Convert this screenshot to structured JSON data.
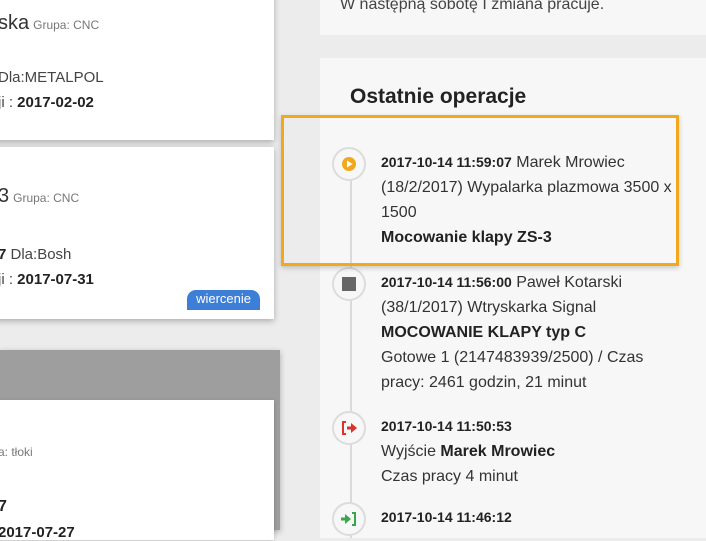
{
  "cards": [
    {
      "title": "ska",
      "group": "Grupa: CNC",
      "line1": "Dla:METALPOL",
      "line2_prefix": "ji : ",
      "line2_value": "2017-02-02"
    },
    {
      "title": "3",
      "group": "Grupa: CNC",
      "line1_num": "7",
      "line1": "Dla:Bosh",
      "line2_prefix": "ji : ",
      "line2_value": "2017-07-31",
      "badge": "wiercenie"
    }
  ],
  "section3": {
    "group": "a: tłoki",
    "num": "7",
    "partial": "2017-07-27"
  },
  "notice": "W następną sobotę I zmiana pracuje.",
  "operations": {
    "title": "Ostatnie operacje",
    "items": [
      {
        "timestamp": "2017-10-14 11:59:07",
        "user": "Marek Mrowiec",
        "detail": "(18/2/2017) Wypalarka plazmowa 3500 x 1500",
        "bold_line": "Mocowanie klapy ZS-3",
        "icon": "play-icon",
        "icon_color": "#f2a81c"
      },
      {
        "timestamp": "2017-10-14 11:56:00",
        "user": "Paweł Kotarski",
        "detail": "(38/1/2017) Wtryskarka Signal",
        "bold_line": "MOCOWANIE KLAPY typ C",
        "extra": "Gotowe 1 (2147483939/2500) / Czas pracy: 2461 godzin, 21 minut",
        "icon": "stop-icon",
        "icon_color": "#666666"
      },
      {
        "timestamp": "2017-10-14 11:50:53",
        "action": "Wyjście",
        "action_user": "Marek Mrowiec",
        "extra": "Czas pracy 4 minut",
        "icon": "sign-out-icon",
        "icon_color": "#d9332b"
      },
      {
        "timestamp": "2017-10-14 11:46:12",
        "icon": "sign-in-icon",
        "icon_color": "#3aa64a"
      }
    ]
  }
}
